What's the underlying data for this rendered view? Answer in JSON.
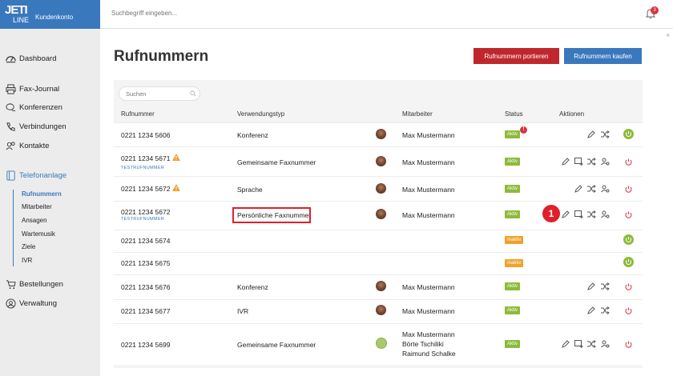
{
  "app": {
    "logo_line1": "JETI",
    "logo_line2": "LINE",
    "subtitle": "Kundenkonto"
  },
  "topbar": {
    "search_placeholder": "Suchbegriff eingeben...",
    "notification_count": "3"
  },
  "sidebar": {
    "collapse": "«",
    "items": [
      {
        "label": "Dashboard"
      },
      {
        "label": "Fax-Journal"
      },
      {
        "label": "Konferenzen"
      },
      {
        "label": "Verbindungen"
      },
      {
        "label": "Kontakte"
      },
      {
        "label": "Telefonanlage"
      },
      {
        "label": "Bestellungen"
      },
      {
        "label": "Verwaltung"
      }
    ],
    "subitems": [
      {
        "label": "Rufnummern"
      },
      {
        "label": "Mitarbeiter"
      },
      {
        "label": "Ansagen"
      },
      {
        "label": "Wartemusik"
      },
      {
        "label": "Ziele"
      },
      {
        "label": "IVR"
      }
    ]
  },
  "page": {
    "title": "Rufnummern",
    "btn_port": "Rufnummern portieren",
    "btn_buy": "Rufnummern kaufen",
    "search_placeholder": "Suchen"
  },
  "table": {
    "headers": [
      "Rufnummer",
      "Verwendungstyp",
      "Mitarbeiter",
      "Status",
      "Aktionen"
    ],
    "test_label": "TESTRUFNUMMER",
    "rows": [
      {
        "number": "0221 1234 5606",
        "type": "Konferenz",
        "employee": "Max Mustermann",
        "status": "Aktiv"
      },
      {
        "number": "0221 1234 5671",
        "type": "Gemeinsame Faxnummer",
        "employee": "Max Mustermann",
        "status": "Aktiv"
      },
      {
        "number": "0221 1234 5672",
        "type": "Sprache",
        "employee": "Max Mustermann",
        "status": "Aktiv"
      },
      {
        "number": "0221 1234 5672",
        "type": "Persönliche Faxnummer",
        "employee": "Max Mustermann",
        "status": "Aktiv"
      },
      {
        "number": "0221 1234 5674",
        "type": "",
        "employee": "",
        "status": "Inaktiv"
      },
      {
        "number": "0221 1234 5675",
        "type": "",
        "employee": "",
        "status": "Inaktiv"
      },
      {
        "number": "0221 1234 5676",
        "type": "Konferenz",
        "employee": "Max Mustermann",
        "status": "Aktiv"
      },
      {
        "number": "0221 1234 5677",
        "type": "IVR",
        "employee": "Max Mustermann",
        "status": "Aktiv"
      },
      {
        "number": "0221 1234 5699",
        "type": "Gemeinsame Faxnummer",
        "employee": [
          "Max Mustermann",
          "Börte Tschiliki",
          "Raimund Schalke"
        ],
        "status": "Aktiv"
      }
    ]
  },
  "annotation": {
    "marker": "1"
  },
  "colors": {
    "primary": "#3a78bd",
    "danger": "#c0272d",
    "active": "#8dba3a",
    "inactive": "#f0a12c"
  }
}
